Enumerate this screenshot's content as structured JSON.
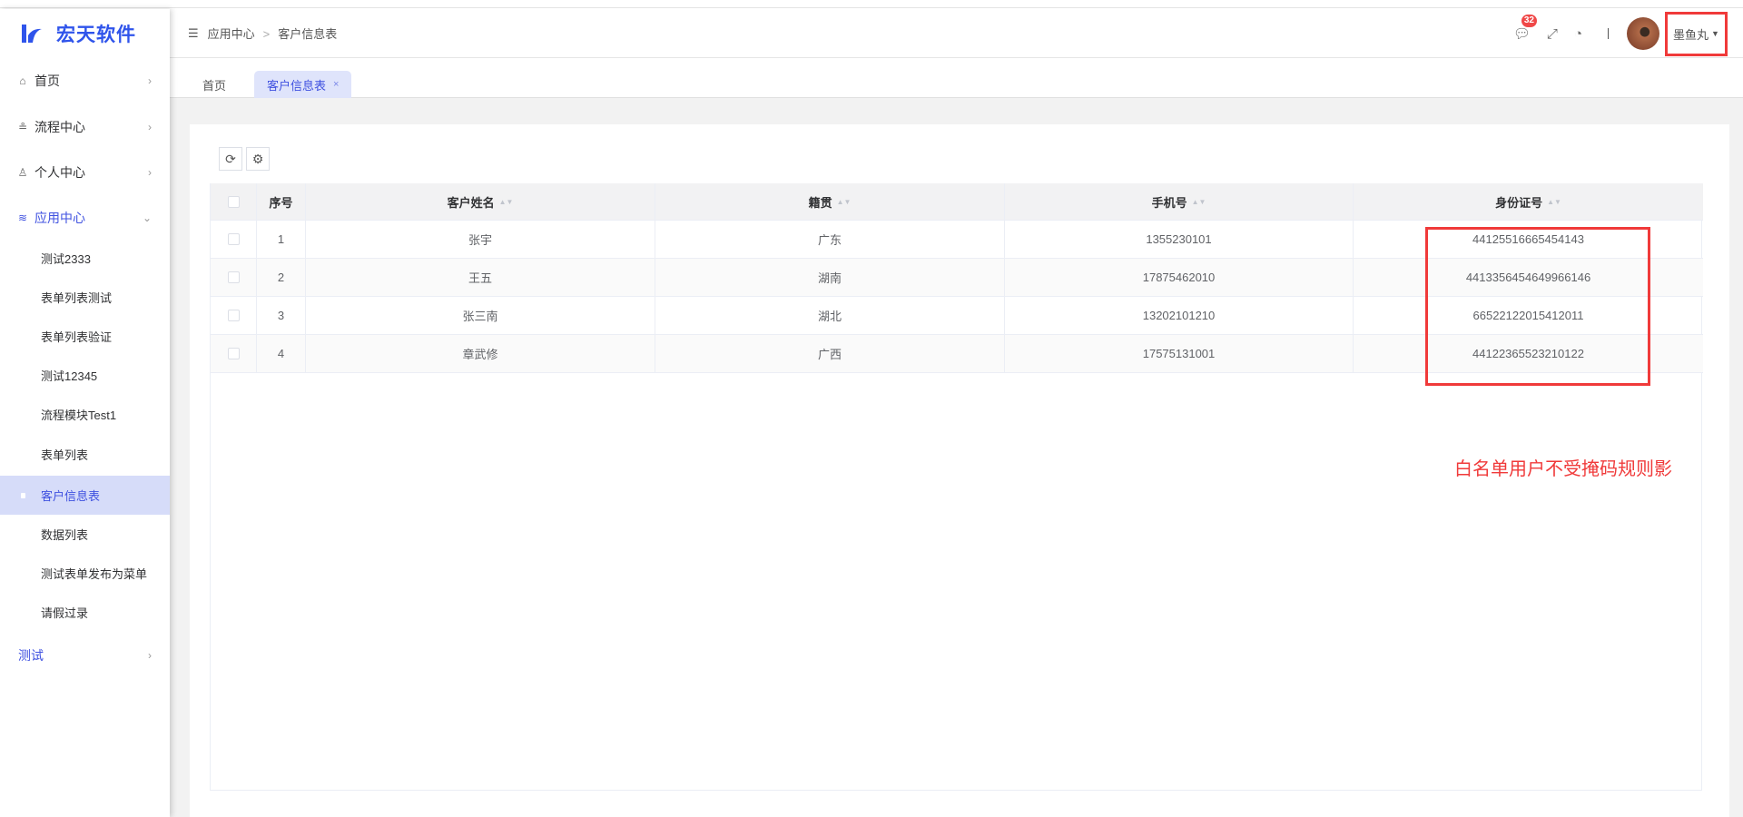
{
  "brand": {
    "name": "宏天软件",
    "color": "#2f54eb"
  },
  "sidebar": {
    "items": [
      {
        "label": "首页",
        "icon": "home-icon"
      },
      {
        "label": "流程中心",
        "icon": "flow-icon"
      },
      {
        "label": "个人中心",
        "icon": "user-icon"
      },
      {
        "label": "应用中心",
        "icon": "layers-icon"
      }
    ],
    "sub_items": [
      "测试2333",
      "表单列表测试",
      "表单列表验证",
      "测试12345",
      "流程模块Test1",
      "表单列表",
      "客户信息表",
      "数据列表",
      "测试表单发布为菜单",
      "请假过录"
    ],
    "active_sub": "客户信息表",
    "last_item": "测试"
  },
  "header": {
    "breadcrumb": [
      "应用中心",
      "客户信息表"
    ],
    "separator": ">",
    "message_count": "32",
    "username": "墨鱼丸"
  },
  "tabs": [
    {
      "label": "首页"
    },
    {
      "label": "客户信息表",
      "close": "×"
    }
  ],
  "table": {
    "columns": [
      "序号",
      "客户姓名",
      "籍贯",
      "手机号",
      "身份证号"
    ],
    "rows": [
      [
        "1",
        "张宇",
        "广东",
        "1355230101",
        "44125516665454143"
      ],
      [
        "2",
        "王五",
        "湖南",
        "17875462010",
        "4413356454649966146"
      ],
      [
        "3",
        "张三南",
        "湖北",
        "13202101210",
        "66522122015412011"
      ],
      [
        "4",
        "章武修",
        "广西",
        "17575131001",
        "44122365523210122"
      ]
    ]
  },
  "annotation": "白名单用户不受掩码规则影",
  "colors": {
    "accent": "#3f51e0",
    "highlight": "#f03a3a"
  }
}
